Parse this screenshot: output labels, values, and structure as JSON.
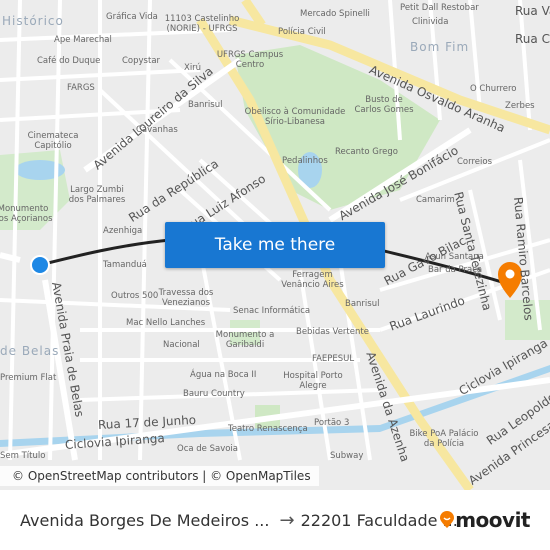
{
  "map": {
    "neighborhoods": [
      "Histórico",
      "Bom Fim",
      "de Belas"
    ],
    "streets": [
      "Avenida Loureiro da Silva",
      "Rua da República",
      "Rua Luiz Afonso",
      "Avenida Osvaldo Aranha",
      "Avenida José Bonifácio",
      "Rua Santa Terezinha",
      "Rua Ramiro Barcelos",
      "Rua Gavo Bilac",
      "Rua Laurindo",
      "Avenida Praia de Belas",
      "Avenida da Azenha",
      "Rua 17 de Junho",
      "Ciclovia Ipiranga",
      "Ciclovia Ipiranga",
      "Rua Leopoldo",
      "Avenida Princesa",
      "Rua Vasco",
      "Rua C"
    ],
    "pois": [
      "Gráfica Vida",
      "11103 Castelinho (NORIE) - UFRGS",
      "Mercado Spinelli",
      "Petit Dall Restobar",
      "Clinivida",
      "Ape Marechal",
      "Polícia Civil",
      "Café do Duque",
      "Copystar",
      "UFRGS Campus Centro",
      "Xirú",
      "FARGS",
      "Banrisul",
      "Obelisco à Comunidade Sírio-Libanesa",
      "Busto de Carlos Gomes",
      "O Churrero",
      "Zerbes",
      "Cavanhas",
      "Cinemateca Capitólio",
      "Recanto Grego",
      "Pedalinhos",
      "Correios",
      "Largo Zumbi dos Palmares",
      "Camarim",
      "Monumento aos Açorianos",
      "Azenhiga",
      "Tamanduá",
      "Asun Santana",
      "Bar da Praça",
      "Ferragem Venâncio Aires",
      "Outros 500",
      "Travessa dos Venezianos",
      "Banrisul",
      "Mac Nello Lanches",
      "Senac Informática",
      "Bebidas Vertente",
      "Nacional",
      "Monumento a Garibaldi",
      "FAEPESUL",
      "Água na Boca II",
      "Premium Flat",
      "Hospital Porto Alegre",
      "Bauru Country",
      "Portão 3",
      "Teatro Renascença",
      "Oca de Savoia",
      "Bike PoA Palácio da Polícia",
      "Subway",
      "Sem Título"
    ],
    "attribution": "© OpenStreetMap contributors | © OpenMapTiles",
    "cta_label": "Take me there",
    "colors": {
      "route": "#222222",
      "button": "#1877d2",
      "origin": "#1e88e5",
      "destination": "#f57c00",
      "park": "#cfe8c4",
      "water": "#a8d4ee",
      "major_road": "#f7e7a0"
    }
  },
  "footer": {
    "origin": "Avenida Borges De Medeiros ...",
    "arrow": "→",
    "destination": "22201 Faculdade ...",
    "brand": "moovit"
  }
}
